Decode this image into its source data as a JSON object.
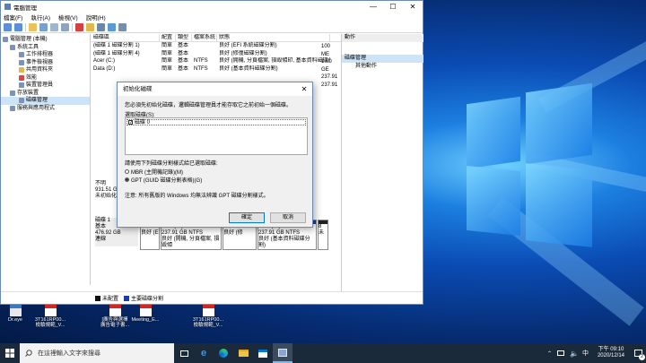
{
  "window": {
    "title": "電腦管理",
    "menu": [
      "檔案(F)",
      "執行(A)",
      "檢視(V)",
      "說明(H)"
    ]
  },
  "tree": [
    {
      "label": "電腦管理 (本機)",
      "indent": 0
    },
    {
      "label": "系統工具",
      "indent": 1
    },
    {
      "label": "工作排程器",
      "indent": 2
    },
    {
      "label": "事件檢視器",
      "indent": 2
    },
    {
      "label": "共用資料夾",
      "indent": 2
    },
    {
      "label": "效能",
      "indent": 2
    },
    {
      "label": "裝置管理員",
      "indent": 2
    },
    {
      "label": "存放裝置",
      "indent": 1
    },
    {
      "label": "磁碟管理",
      "indent": 2,
      "selected": true
    },
    {
      "label": "服務與應用程式",
      "indent": 1
    }
  ],
  "volume_headers": [
    "磁碟區",
    "配置",
    "類型",
    "檔案系統",
    "狀態"
  ],
  "volumes": [
    [
      "(磁碟 1 磁碟分割 1)",
      "簡單",
      "基本",
      "",
      "良好 (EFI 系統磁碟分割)"
    ],
    [
      "(磁碟 1 磁碟分割 4)",
      "簡單",
      "基本",
      "",
      "良好 (修復磁碟分割)"
    ],
    [
      "Acer (C:)",
      "簡單",
      "基本",
      "NTFS",
      "良好 (開機, 分頁檔案, 損毀傾印, 基本資料磁碟分割)"
    ],
    [
      "Data (D:)",
      "簡單",
      "基本",
      "NTFS",
      "良好 (基本資料磁碟分割)"
    ]
  ],
  "capacity_col": [
    "100 ME",
    "1.00 GE",
    "237.91",
    "237.91"
  ],
  "actions": {
    "header": "動作",
    "selected": "磁碟管理",
    "more": "其他動作"
  },
  "disk0": {
    "status": "不明",
    "size": "931.51 G",
    "state": "未初始化"
  },
  "disk1": {
    "name": "磁碟 1",
    "type": "基本",
    "size": "476.92 GB",
    "state": "連線",
    "parts": [
      {
        "l1": "100 MI",
        "l2": "良好 (E"
      },
      {
        "l1": "Acer (C:)",
        "l2": "237.91 GB NTFS",
        "l3": "良好 (開機, 分頁檔案, 損毀傾"
      },
      {
        "l1": "1.00 GB",
        "l2": "良好 (修"
      },
      {
        "l1": "Data (D:)",
        "l2": "237.91 GB NTFS",
        "l3": "良好 (基本資料磁碟分割)"
      },
      {
        "l1": "8",
        "l2": "未"
      }
    ]
  },
  "legend": [
    "未配置",
    "主要磁碟分割"
  ],
  "dialog": {
    "title": "初始化磁碟",
    "intro": "您必須先初始化磁碟，邏輯磁碟管理員才能存取它之前初始一個磁碟。",
    "select_label": "選取磁碟(S):",
    "disk_item": "磁碟 0",
    "style_label": "請使用下列磁碟分割樣式給已選取磁碟:",
    "mbr": "MBR (主開機記錄)(M)",
    "gpt": "GPT (GUID 磁碟分割表格)(G)",
    "note": "注意: 所有舊版的 Windows 均無法辨識 GPT 磁碟分割樣式。",
    "ok": "確定",
    "cancel": "取消"
  },
  "desktop_icons": [
    {
      "label1": "Dr.eye",
      "label2": ""
    },
    {
      "label1": "3T161RP00...",
      "label2": "檢驗規範_V..."
    },
    {
      "label1": "[廣告與選擇",
      "label2": "廣告電子書..."
    },
    {
      "label1": "Meeting_E...",
      "label2": ""
    },
    {
      "label1": "3T161RP00...",
      "label2": "檢驗規範_V..."
    }
  ],
  "left_edge_labels": [
    "資",
    "E",
    "E"
  ],
  "taskbar": {
    "search_placeholder": "在這裡輸入文字來搜尋",
    "time": "下午 09:10",
    "date": "2020/12/14",
    "notif_badge": "2"
  }
}
